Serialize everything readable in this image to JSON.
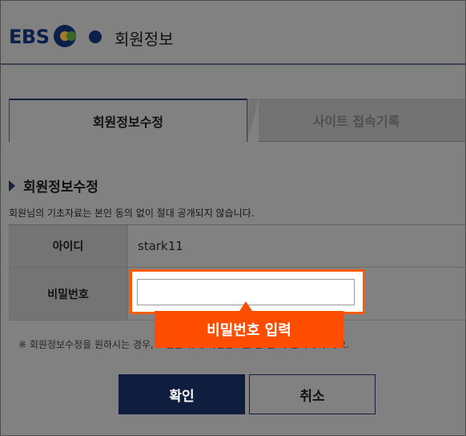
{
  "header": {
    "logo_text": "EBS",
    "title": "회원정보"
  },
  "tabs": [
    {
      "label": "회원정보수정",
      "active": true
    },
    {
      "label": "사이트 접속기록",
      "active": false
    }
  ],
  "section": {
    "title": "회원정보수정",
    "description": "회원님의 기초자료는 본인 동의 없이 절대 공개되지 않습니다."
  },
  "form": {
    "id_label": "아이디",
    "id_value": "stark11",
    "password_label": "비밀번호",
    "password_value": ""
  },
  "callout": {
    "text": "비밀번호 입력"
  },
  "note": "※ 회원정보수정을 원하시는 경우, 보안을 위해 비밀번호를 한 번 더 입력해 주세요.",
  "buttons": {
    "confirm": "확인",
    "cancel": "취소"
  },
  "colors": {
    "navy": "#0f1e3f",
    "highlight": "#ff5a00"
  }
}
